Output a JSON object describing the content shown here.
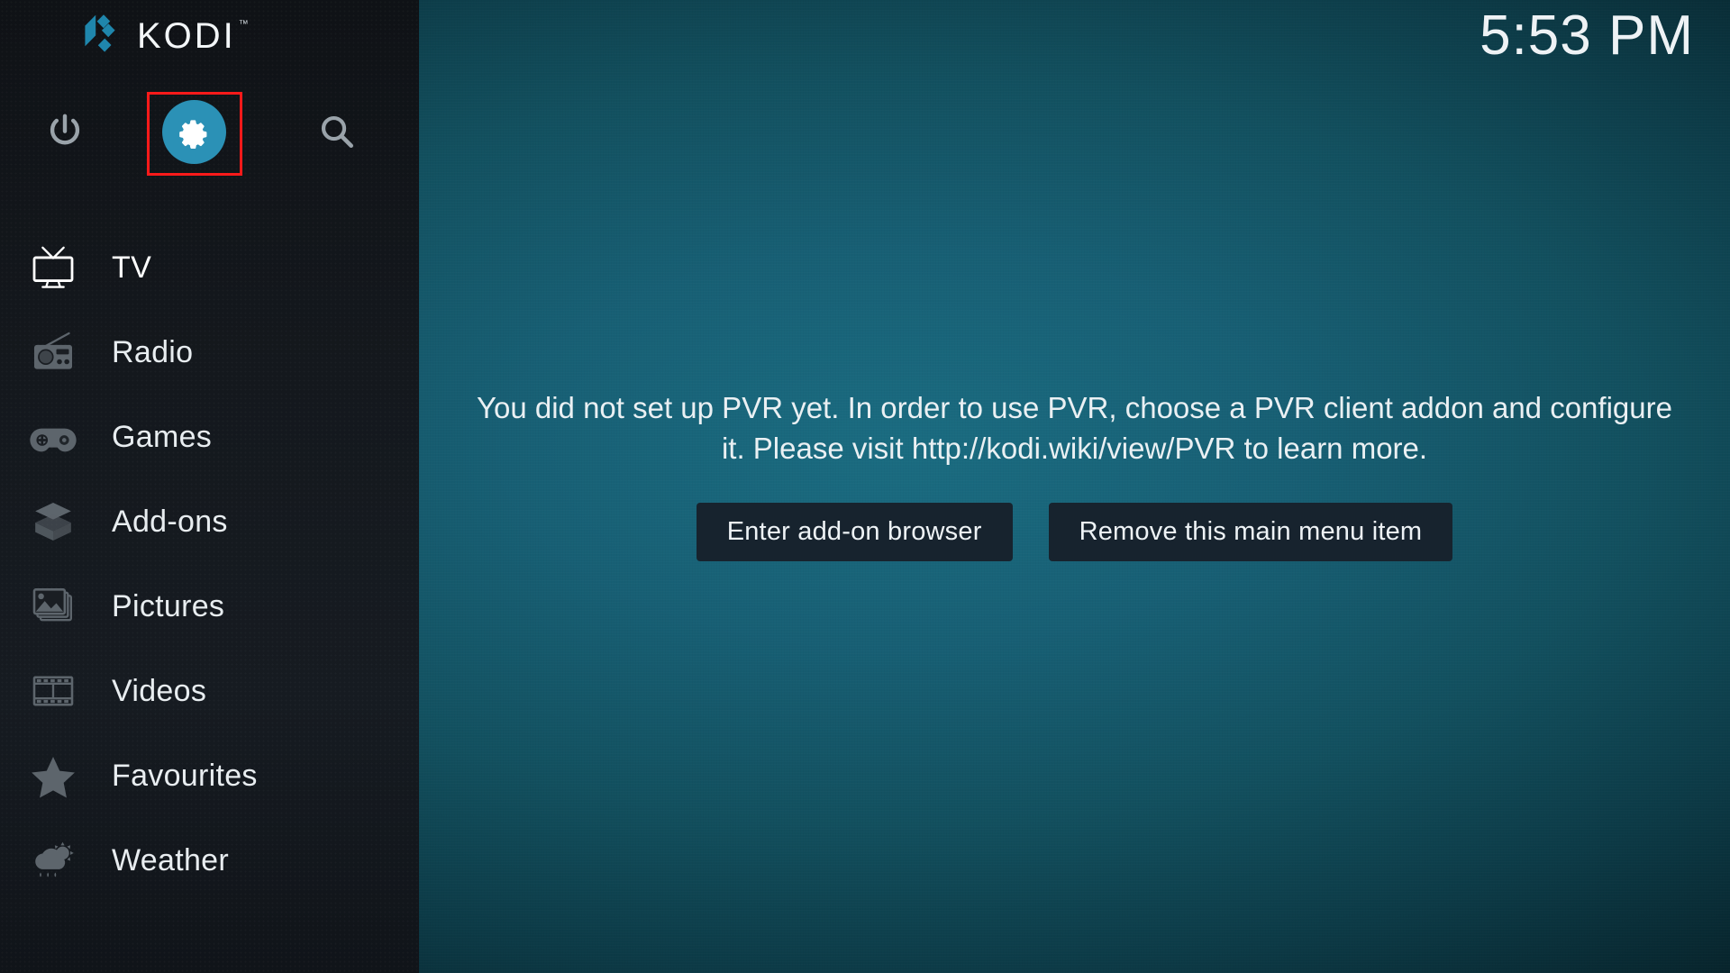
{
  "app": {
    "name": "KODI",
    "trademark": "™"
  },
  "clock": {
    "time": "5:53 PM"
  },
  "sidebar": {
    "top_actions": [
      {
        "name": "power",
        "icon": "power-icon",
        "label": "Power"
      },
      {
        "name": "settings",
        "icon": "gear-icon",
        "label": "Settings",
        "highlighted": true
      },
      {
        "name": "search",
        "icon": "search-icon",
        "label": "Search"
      }
    ],
    "items": [
      {
        "label": "TV",
        "icon": "tv-icon",
        "selected": true
      },
      {
        "label": "Radio",
        "icon": "radio-icon",
        "selected": false
      },
      {
        "label": "Games",
        "icon": "gamepad-icon",
        "selected": false
      },
      {
        "label": "Add-ons",
        "icon": "package-icon",
        "selected": false
      },
      {
        "label": "Pictures",
        "icon": "pictures-icon",
        "selected": false
      },
      {
        "label": "Videos",
        "icon": "filmstrip-icon",
        "selected": false
      },
      {
        "label": "Favourites",
        "icon": "star-icon",
        "selected": false
      },
      {
        "label": "Weather",
        "icon": "weather-icon",
        "selected": false
      }
    ]
  },
  "main": {
    "message": "You did not set up PVR yet. In order to use PVR, choose a PVR client addon and configure it. Please visit http://kodi.wiki/view/PVR to learn more.",
    "buttons": [
      {
        "label": "Enter add-on browser"
      },
      {
        "label": "Remove this main menu item"
      }
    ]
  },
  "colors": {
    "accent": "#2b91b6",
    "logo_blue": "#1f86ac",
    "highlight_red": "#fb1a1a",
    "sidebar_bg": "#14181d",
    "content_bg": "#175f74",
    "button_bg": "#17232e",
    "text_primary": "#eef2f5",
    "icon_dim": "#5d656c"
  }
}
